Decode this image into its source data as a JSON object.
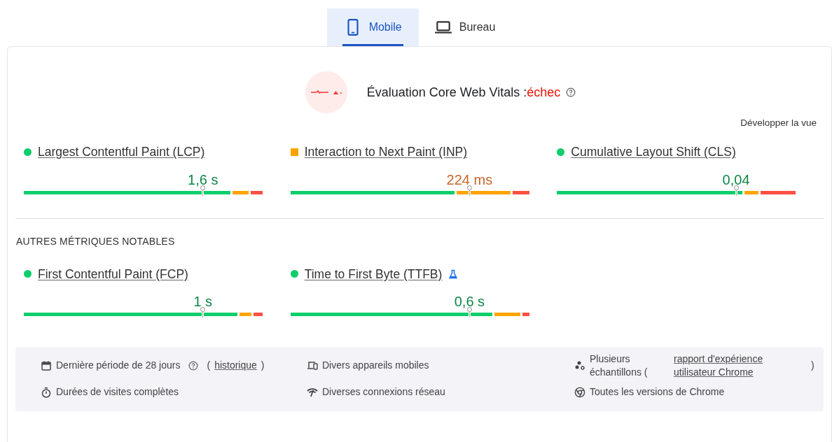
{
  "tabs": [
    {
      "label": "Mobile",
      "selected": true
    },
    {
      "label": "Bureau",
      "selected": false
    }
  ],
  "assessment": {
    "label": "Évaluation Core Web Vitals :",
    "result": "échec",
    "passed": false,
    "expand_link": "Développer la vue"
  },
  "core_metrics": [
    {
      "name": "Largest Contentful Paint (LCP)",
      "kind": "good",
      "value": "1,6 s",
      "experimental": false
    },
    {
      "name": "Interaction to Next Paint (INP)",
      "kind": "needs_improvement",
      "value": "224 ms",
      "experimental": false
    },
    {
      "name": "Cumulative Layout Shift (CLS)",
      "kind": "good",
      "value": "0,04",
      "experimental": false
    }
  ],
  "other_metrics_heading": "AUTRES MÉTRIQUES NOTABLES",
  "other_metrics": [
    {
      "name": "First Contentful Paint (FCP)",
      "kind": "good",
      "value": "1 s",
      "experimental": false
    },
    {
      "name": "Time to First Byte (TTFB)",
      "kind": "good",
      "value": "0,6 s",
      "experimental": true
    }
  ],
  "footer": [
    {
      "parts": [
        {
          "kind": "text",
          "text": "Dernière période de 28 jours"
        },
        {
          "kind": "help"
        },
        {
          "kind": "text",
          "text": "("
        },
        {
          "kind": "link",
          "text": "historique"
        },
        {
          "kind": "text",
          "text": ")"
        }
      ]
    },
    {
      "parts": [
        {
          "kind": "text",
          "text": "Divers appareils mobiles"
        }
      ]
    },
    {
      "parts": [
        {
          "kind": "text",
          "text": "Plusieurs échantillons ("
        },
        {
          "kind": "link",
          "text": "rapport d'expérience utilisateur Chrome"
        },
        {
          "kind": "text",
          "text": ")"
        }
      ]
    },
    {
      "parts": [
        {
          "kind": "text",
          "text": "Durées de visites complètes"
        }
      ]
    },
    {
      "parts": [
        {
          "kind": "text",
          "text": "Diverses connexions réseau"
        }
      ]
    },
    {
      "parts": [
        {
          "kind": "text",
          "text": "Toutes les versions de Chrome"
        }
      ]
    }
  ]
}
